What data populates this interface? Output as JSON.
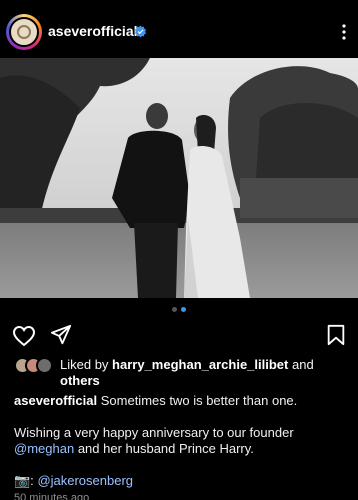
{
  "post": {
    "username": "aseverofficial",
    "verified": true
  },
  "carousel": {
    "current": 2,
    "total": 2
  },
  "likes": {
    "prefix": "Liked by",
    "user": "harry_meghan_archie_lilibet",
    "and": "and",
    "others": "others"
  },
  "caption": {
    "username": "aseverofficial",
    "line1": "Sometimes two is better than one.",
    "line2a": "Wishing a very happy anniversary to our founder",
    "mention": "@meghan",
    "line2b": "and her husband Prince Harry.",
    "camera_emoji": "📷:",
    "credit": "@jakerosenberg"
  },
  "timestamp": "50 minutes ago",
  "colors": {
    "accent_blue": "#3897f0",
    "link": "#9ac1ff",
    "background": "#000000"
  },
  "icons": [
    "verified-badge-icon",
    "more-options-icon",
    "heart-icon",
    "share-icon",
    "bookmark-icon"
  ]
}
